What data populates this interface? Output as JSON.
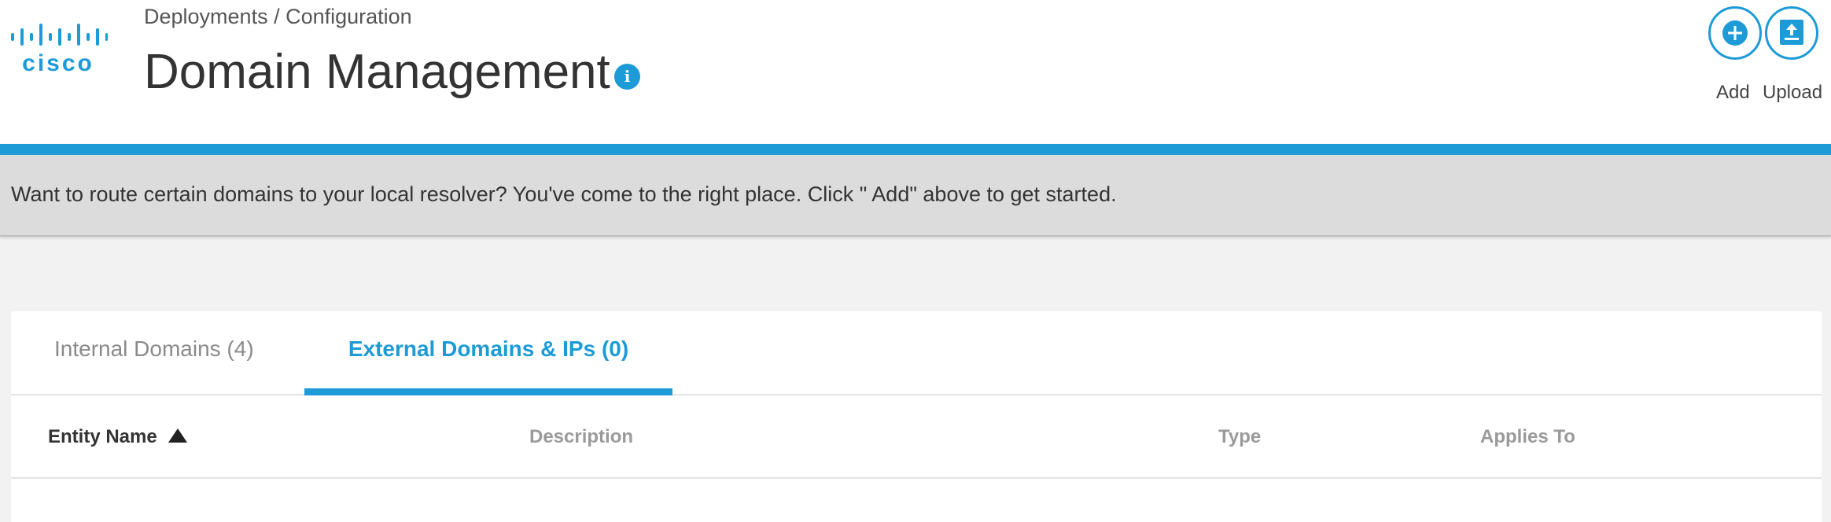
{
  "header": {
    "logo_text": "cisco",
    "breadcrumb": "Deployments / Configuration",
    "title": "Domain Management",
    "info_icon": "info-icon"
  },
  "actions": [
    {
      "label": "Add",
      "icon": "plus-circle-icon"
    },
    {
      "label": "Upload",
      "icon": "upload-icon"
    }
  ],
  "banner": {
    "text": "Want to route certain domains to your local resolver? You've come to the right place. Click \" Add\"  above to get started."
  },
  "tabs": [
    {
      "label": "Internal Domains (4)",
      "active": false
    },
    {
      "label": "External Domains & IPs (0)",
      "active": true
    }
  ],
  "table": {
    "columns": [
      {
        "label": "Entity Name",
        "sorted": "ascending"
      },
      {
        "label": "Description"
      },
      {
        "label": "Type"
      },
      {
        "label": "Applies To"
      }
    ]
  },
  "colors": {
    "accent": "#1d9bd6",
    "banner_bg": "#dcdcdc",
    "page_bg": "#f2f2f2"
  }
}
